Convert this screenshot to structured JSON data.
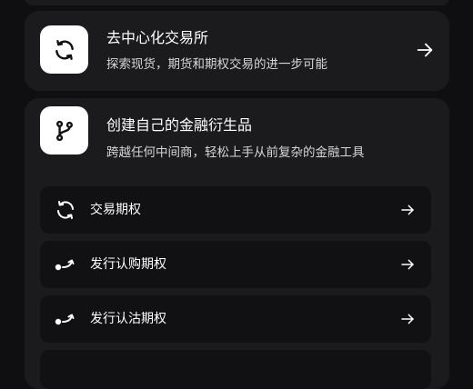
{
  "cards": [
    {
      "title": "去中心化交易所",
      "description": "探索现货，期货和期权交易的进一步可能",
      "icon": "refresh-icon"
    },
    {
      "title": "创建自己的金融衍生品",
      "description": "跨越任何中间商，轻松上手从前复杂的金融工具",
      "icon": "git-branch-icon"
    }
  ],
  "actions": [
    {
      "label": "交易期权",
      "icon": "refresh-icon"
    },
    {
      "label": "发行认购期权",
      "icon": "call-curve-icon"
    },
    {
      "label": "发行认沽期权",
      "icon": "put-curve-icon"
    }
  ],
  "colors": {
    "background": "#0f0f11",
    "card": "#1b1b1e",
    "row": "#111113",
    "text": "#ffffff",
    "muted": "#d6d6d8"
  }
}
